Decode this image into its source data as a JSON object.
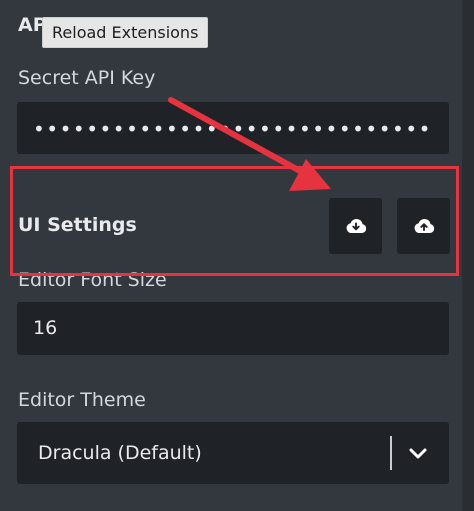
{
  "tooltip": {
    "text": "Reload Extensions"
  },
  "api_section": {
    "heading": "API"
  },
  "secret_api_key": {
    "label": "Secret API Key",
    "value": "••••••••••••••••••••••••••••••"
  },
  "ui_settings": {
    "title": "UI Settings",
    "download_icon": "cloud-download-icon",
    "upload_icon": "cloud-upload-icon"
  },
  "editor_font_size": {
    "label": "Editor Font Size",
    "value": "16"
  },
  "editor_theme": {
    "label": "Editor Theme",
    "selected": "Dracula (Default)"
  },
  "annotation": {
    "color": "#e5333f"
  }
}
